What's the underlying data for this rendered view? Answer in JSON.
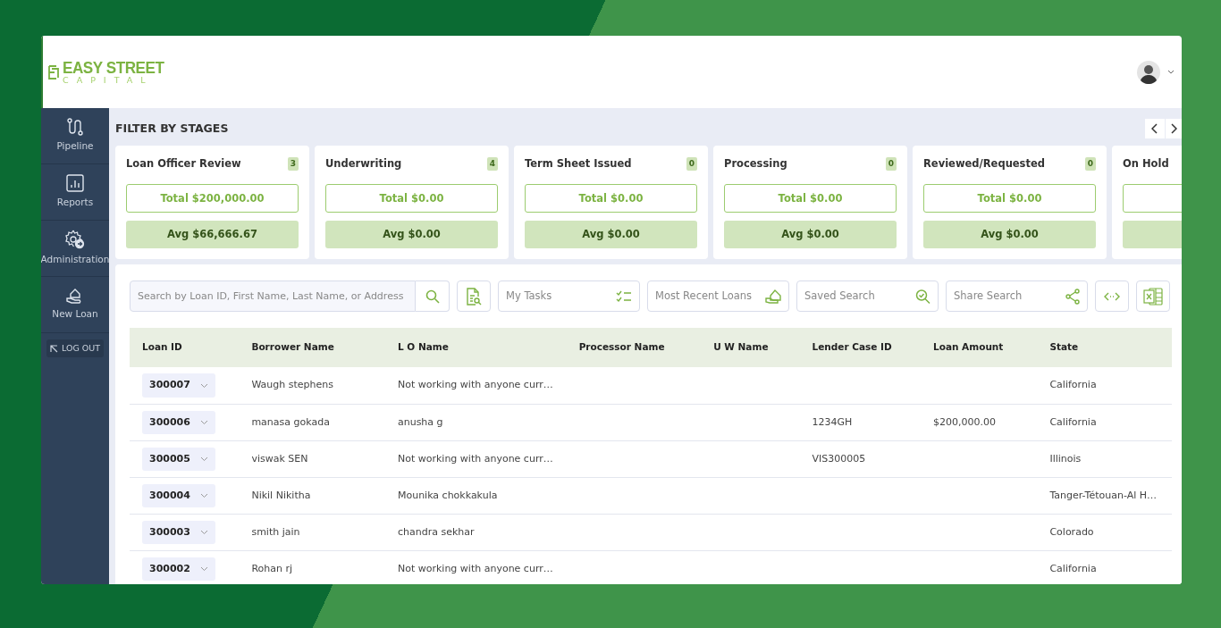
{
  "logo": {
    "name": "EASY STREET",
    "tagline": "CAPITAL"
  },
  "sidebar": {
    "items": [
      {
        "label": "Pipeline"
      },
      {
        "label": "Reports"
      },
      {
        "label": "Administration"
      },
      {
        "label": "New Loan"
      }
    ],
    "logout": "LOG OUT"
  },
  "stages_title": "FILTER BY STAGES",
  "stages": [
    {
      "name": "Loan Officer Review",
      "count": "3",
      "total": "Total $200,000.00",
      "avg": "Avg $66,666.67"
    },
    {
      "name": "Underwriting",
      "count": "4",
      "total": "Total $0.00",
      "avg": "Avg $0.00"
    },
    {
      "name": "Term Sheet Issued",
      "count": "0",
      "total": "Total $0.00",
      "avg": "Avg $0.00"
    },
    {
      "name": "Processing",
      "count": "0",
      "total": "Total $0.00",
      "avg": "Avg $0.00"
    },
    {
      "name": "Reviewed/Requested",
      "count": "0",
      "total": "Total $0.00",
      "avg": "Avg $0.00"
    },
    {
      "name": "On Hold"
    }
  ],
  "search": {
    "placeholder": "Search by Loan ID, First Name, Last Name, or Address"
  },
  "tools": [
    {
      "kind": "icon"
    },
    {
      "kind": "field",
      "placeholder": "My Tasks"
    },
    {
      "kind": "field",
      "placeholder": "Most Recent Loans"
    },
    {
      "kind": "field",
      "placeholder": "Saved Search"
    },
    {
      "kind": "field",
      "placeholder": "Share Search"
    },
    {
      "kind": "icon"
    },
    {
      "kind": "icon"
    }
  ],
  "table": {
    "columns": [
      "Loan ID",
      "Borrower Name",
      "L O Name",
      "Processor Name",
      "U W Name",
      "Lender Case ID",
      "Loan Amount",
      "State"
    ],
    "rows": [
      [
        "300007",
        "Waugh stephens",
        "Not working with anyone curr…",
        "",
        "",
        "",
        "",
        "California"
      ],
      [
        "300006",
        "manasa gokada",
        "anusha g",
        "",
        "",
        "1234GH",
        "$200,000.00",
        "California"
      ],
      [
        "300005",
        "viswak SEN",
        "Not working with anyone curr…",
        "",
        "",
        "VIS300005",
        "",
        "Illinois"
      ],
      [
        "300004",
        "Nikil Nikitha",
        "Mounika chokkakula",
        "",
        "",
        "",
        "",
        "Tanger-Tétouan-Al H…"
      ],
      [
        "300003",
        "smith jain",
        "chandra sekhar",
        "",
        "",
        "",
        "",
        "Colorado"
      ],
      [
        "300002",
        "Rohan rj",
        "Not working with anyone curr…",
        "",
        "",
        "",
        "",
        "California"
      ]
    ]
  }
}
